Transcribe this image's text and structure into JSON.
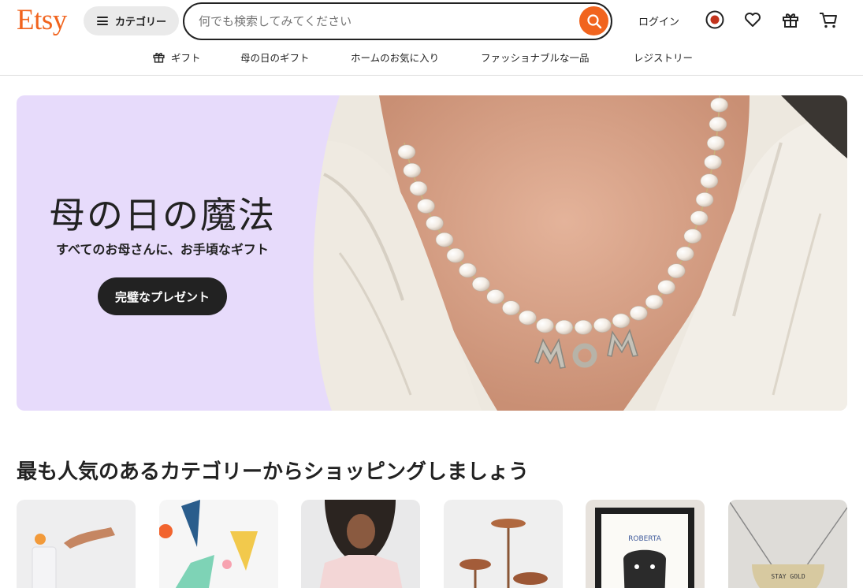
{
  "header": {
    "logo": "Etsy",
    "categories_label": "カテゴリー",
    "search_placeholder": "何でも検索してみてください",
    "login_label": "ログイン",
    "icons": [
      "search-icon",
      "record-icon",
      "heart-icon",
      "gift-icon",
      "cart-icon"
    ]
  },
  "nav": {
    "items": [
      {
        "label": "ギフト",
        "icon": "gift-icon"
      },
      {
        "label": "母の日のギフト"
      },
      {
        "label": "ホームのお気に入り"
      },
      {
        "label": "ファッショナブルな一品"
      },
      {
        "label": "レジストリー"
      }
    ]
  },
  "hero": {
    "title": "母の日の魔法",
    "subtitle": "すべてのお母さんに、お手頃なギフト",
    "button_label": "完璧なプレゼント",
    "image_caption": "MOM",
    "background_color": "#e7dbfb"
  },
  "categories": {
    "title": "最も人気のあるカテゴリーからショッピングしましょう",
    "cards": [
      {
        "image": "home-decor-photo"
      },
      {
        "image": "party-hats-photo"
      },
      {
        "image": "clothing-photo"
      },
      {
        "image": "copper-art-photo"
      },
      {
        "image": "pet-portrait-photo",
        "image_text": "ROBERTA"
      },
      {
        "image": "necklace-photo",
        "image_text": "STAY GOLD"
      }
    ]
  },
  "colors": {
    "brand": "#f1641e",
    "dark": "#222222"
  }
}
